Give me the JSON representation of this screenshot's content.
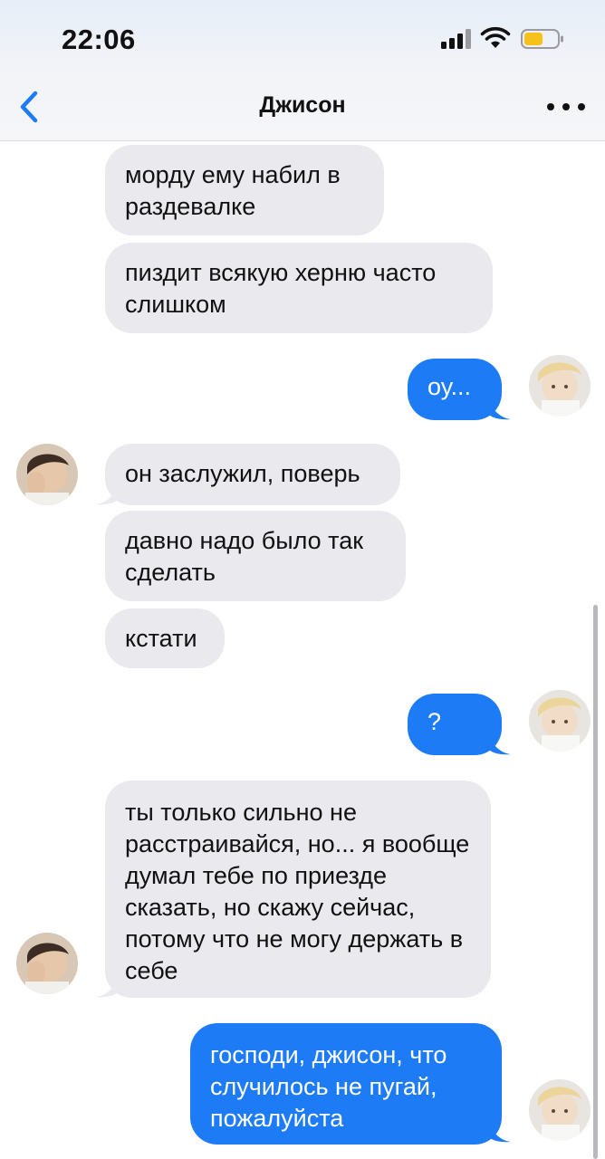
{
  "status_bar": {
    "time": "22:06",
    "icons": [
      "signal-icon",
      "wifi-icon",
      "battery-icon"
    ]
  },
  "header": {
    "title": "Джисон",
    "back_icon": "chevron-left-icon",
    "more_icon": "ellipsis-icon"
  },
  "colors": {
    "incoming_bubble": "#e9e9ee",
    "outgoing_bubble": "#1e7bf6",
    "accent": "#1e7bf6"
  },
  "messages": [
    {
      "side": "incoming",
      "text": "морду ему набил в раздевалке"
    },
    {
      "side": "incoming",
      "text": "пиздит всякую херню часто слишком"
    },
    {
      "side": "outgoing",
      "text": "оу..."
    },
    {
      "side": "incoming",
      "text": "он заслужил, поверь"
    },
    {
      "side": "incoming",
      "text": "давно надо было так сделать"
    },
    {
      "side": "incoming",
      "text": "кстати"
    },
    {
      "side": "outgoing",
      "text": "?"
    },
    {
      "side": "incoming",
      "text": "ты только сильно не расстраивайся, но... я вообще думал тебе по приезде сказать, но скажу сейчас, потому что не могу держать в себе"
    },
    {
      "side": "outgoing",
      "text": "господи, джисон, что случилось не пугай, пожалуйста"
    }
  ]
}
